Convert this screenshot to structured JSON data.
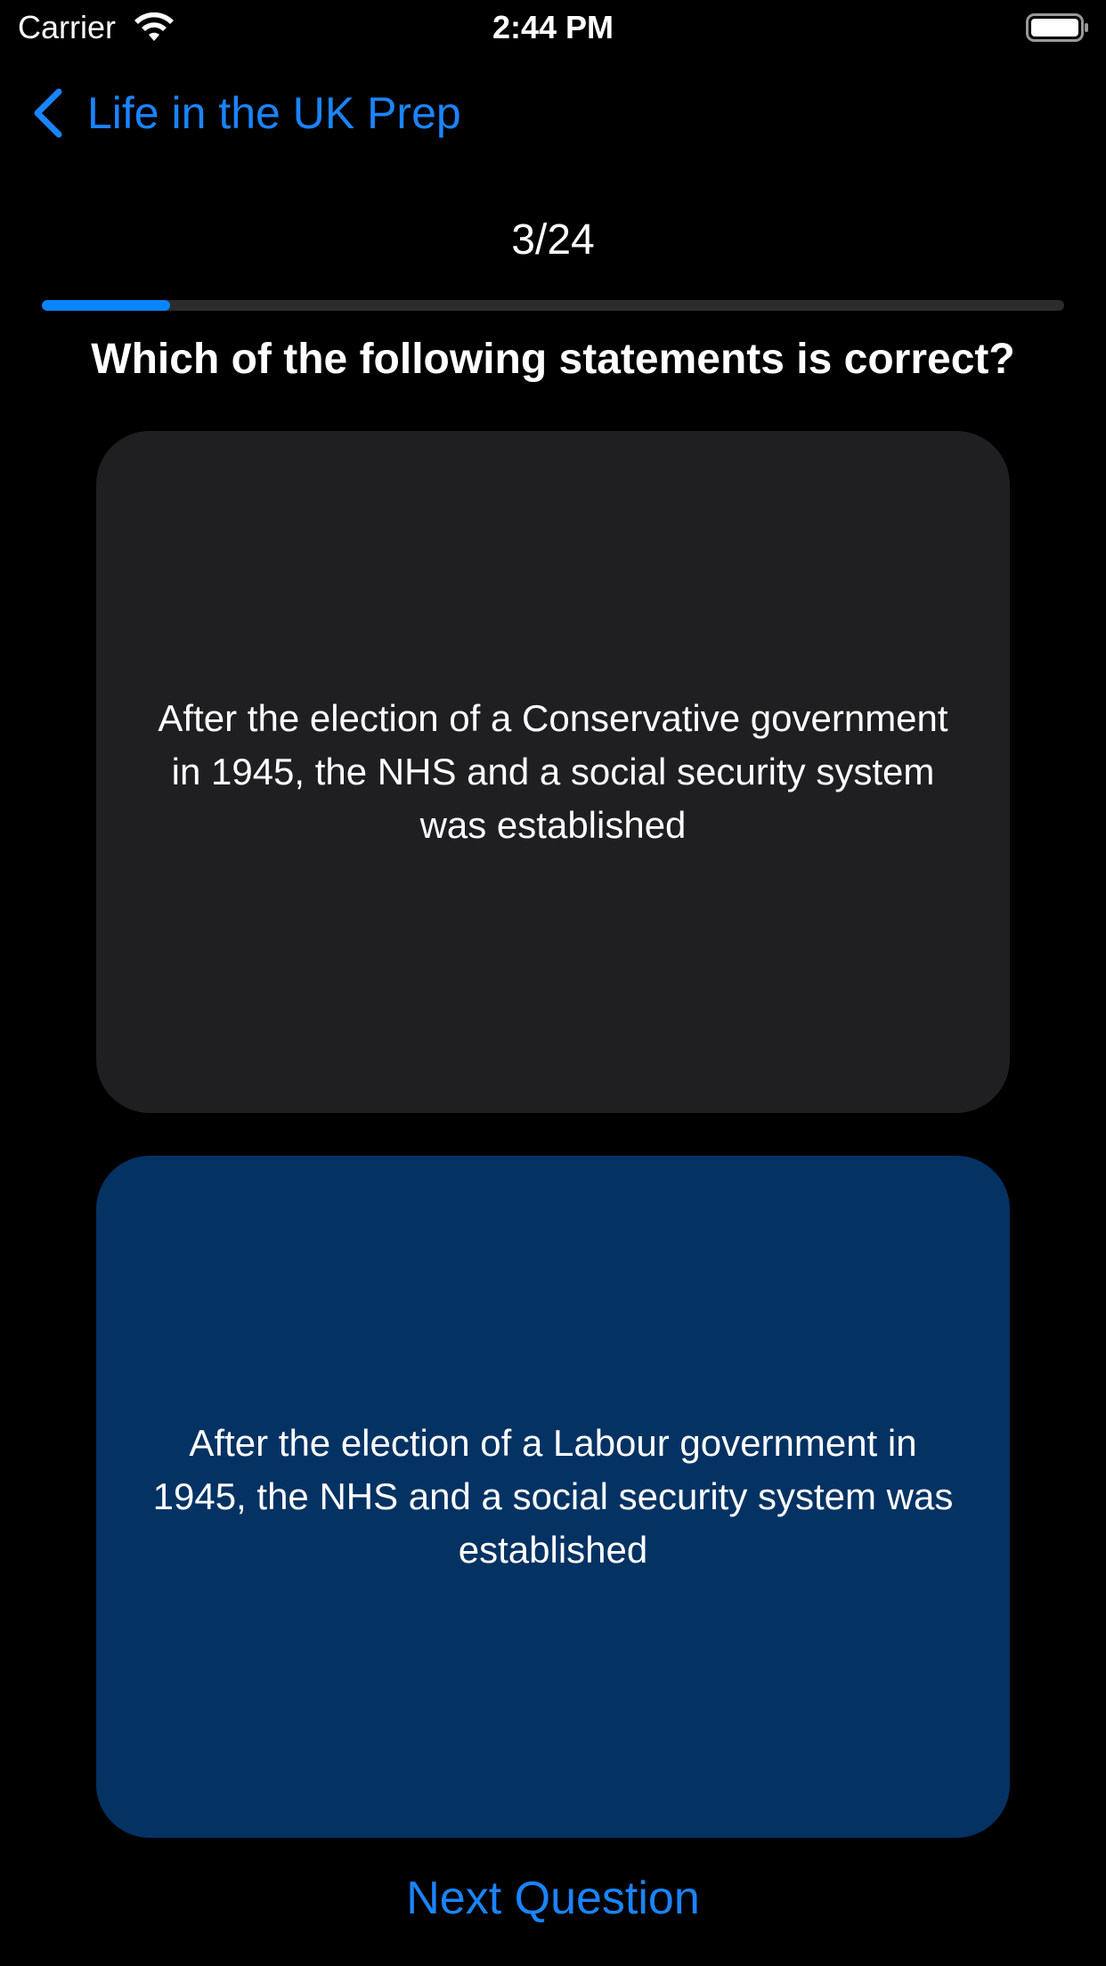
{
  "status_bar": {
    "carrier": "Carrier",
    "time": "2:44 PM",
    "wifi_icon": "wifi-icon",
    "battery_icon": "battery-full-icon"
  },
  "nav": {
    "back_label": "Life in the UK Prep",
    "back_icon": "chevron-left-icon",
    "accent_color": "#1a84ff"
  },
  "progress": {
    "label": "3/24",
    "current": 3,
    "total": 24,
    "fraction": 0.125
  },
  "question": {
    "text": "Which of the following statements is correct?"
  },
  "answers": [
    {
      "text": "After the election of a Conservative government in 1945, the NHS and a social security system was established",
      "background": "#1f1f21",
      "selected": false
    },
    {
      "text": "After the election of a Labour government in 1945, the NHS and a social security system was established",
      "background": "#043263",
      "selected": true
    }
  ],
  "footer": {
    "next_label": "Next Question"
  }
}
